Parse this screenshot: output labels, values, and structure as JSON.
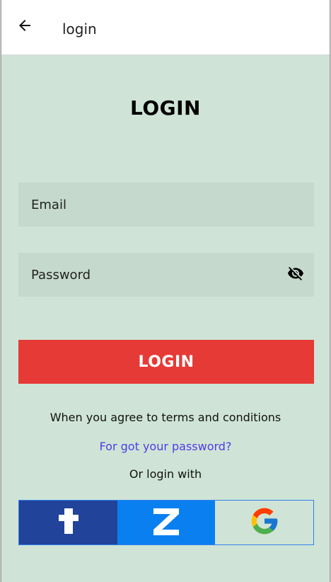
{
  "appbar": {
    "title": "login",
    "back_icon": "arrow-left-icon"
  },
  "page": {
    "heading": "LOGIN"
  },
  "form": {
    "email": {
      "placeholder": "Email",
      "value": ""
    },
    "password": {
      "placeholder": "Password",
      "value": "",
      "toggle_icon": "eye-off-icon"
    },
    "submit_label": "LOGIN"
  },
  "links": {
    "terms": "When you agree to terms and conditions",
    "forgot_password": "For got your password?",
    "or_login_with": "Or login with"
  },
  "social": [
    {
      "name": "tumblr",
      "icon": "tumblr-icon",
      "color": "#21439a"
    },
    {
      "name": "zalo",
      "icon": "zalo-icon",
      "color": "#0a80f0"
    },
    {
      "name": "google",
      "icon": "google-icon",
      "color": "#cfe4d6"
    }
  ],
  "colors": {
    "background": "#cfe4d6",
    "input_background": "#c5d9cd",
    "primary_button": "#e63a37",
    "link": "#4f3be8"
  }
}
